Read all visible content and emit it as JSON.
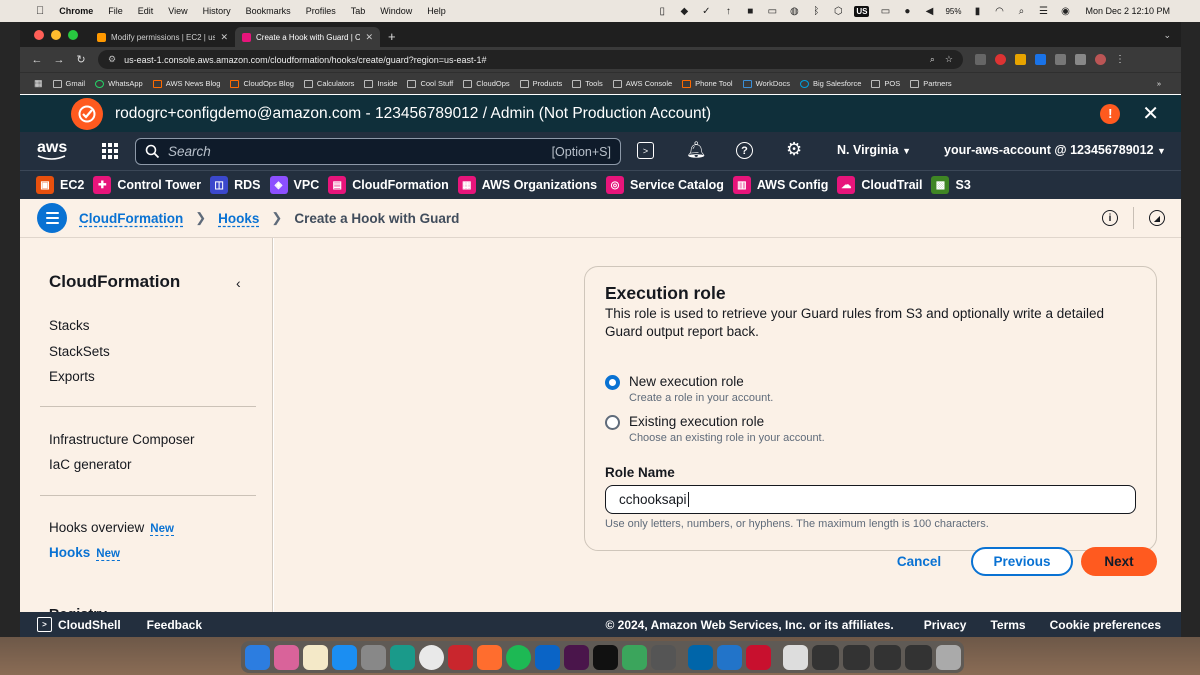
{
  "menubar": {
    "app": "Chrome",
    "items": [
      "File",
      "Edit",
      "View",
      "History",
      "Bookmarks",
      "Profiles",
      "Tab",
      "Window",
      "Help"
    ],
    "battery": "95%",
    "datetime": "Mon Dec 2  12:10 PM",
    "us": "US"
  },
  "browser": {
    "tabs": [
      {
        "title": "Modify permissions | EC2 | us",
        "fav": "#ff9900"
      },
      {
        "title": "Create a Hook with Guard | Cl",
        "fav": "#e7157b"
      }
    ],
    "url": "us-east-1.console.aws.amazon.com/cloudformation/hooks/create/guard?region=us-east-1#",
    "bookmarks": [
      "Gmail",
      "WhatsApp",
      "AWS News Blog",
      "CloudOps Blog",
      "Calculators",
      "Inside",
      "Cool Stuff",
      "CloudOps",
      "Products",
      "Tools",
      "AWS Console",
      "Phone Tool",
      "WorkDocs",
      "Big Salesforce",
      "POS",
      "Partners"
    ]
  },
  "banner": {
    "text": "rodogrc+configdemo@amazon.com - 123456789012 / Admin (Not Production Account)"
  },
  "topnav": {
    "search_placeholder": "Search",
    "search_shortcut": "[Option+S]",
    "region": "N. Virginia",
    "account": "your-aws-account @ 123456789012"
  },
  "services": [
    {
      "label": "EC2",
      "color": "#e7500d"
    },
    {
      "label": "Control Tower",
      "color": "#e7157b"
    },
    {
      "label": "RDS",
      "color": "#3b48cc"
    },
    {
      "label": "VPC",
      "color": "#8c4fff"
    },
    {
      "label": "CloudFormation",
      "color": "#e7157b"
    },
    {
      "label": "AWS Organizations",
      "color": "#e7157b"
    },
    {
      "label": "Service Catalog",
      "color": "#e7157b"
    },
    {
      "label": "AWS Config",
      "color": "#e7157b"
    },
    {
      "label": "CloudTrail",
      "color": "#e7157b"
    },
    {
      "label": "S3",
      "color": "#3f8624"
    }
  ],
  "breadcrumb": {
    "items": [
      "CloudFormation",
      "Hooks"
    ],
    "current": "Create a Hook with Guard"
  },
  "sidebar": {
    "title": "CloudFormation",
    "group1": [
      "Stacks",
      "StackSets",
      "Exports"
    ],
    "group2": [
      "Infrastructure Composer",
      "IaC generator"
    ],
    "hooks_overview": "Hooks overview",
    "hooks": "Hooks",
    "new_badge": "New",
    "registry": "Registry"
  },
  "card": {
    "title": "Execution role",
    "description": "This role is used to retrieve your Guard rules from S3 and optionally write a detailed Guard output report back.",
    "options": [
      {
        "label": "New execution role",
        "desc": "Create a role in your account.",
        "selected": true
      },
      {
        "label": "Existing execution role",
        "desc": "Choose an existing role in your account.",
        "selected": false
      }
    ],
    "role_label": "Role Name",
    "role_value": "cchooksapi",
    "role_hint": "Use only letters, numbers, or hyphens. The maximum length is 100 characters."
  },
  "actions": {
    "cancel": "Cancel",
    "previous": "Previous",
    "next": "Next"
  },
  "footer": {
    "cloudshell": "CloudShell",
    "feedback": "Feedback",
    "copyright": "© 2024, Amazon Web Services, Inc. or its affiliates.",
    "privacy": "Privacy",
    "terms": "Terms",
    "cookies": "Cookie preferences"
  },
  "colors": {
    "accent": "#0972d3",
    "next": "#ff5a1f",
    "nav": "#232f3e",
    "banner": "#0f2f3a",
    "page_bg": "#fbf1e7"
  }
}
